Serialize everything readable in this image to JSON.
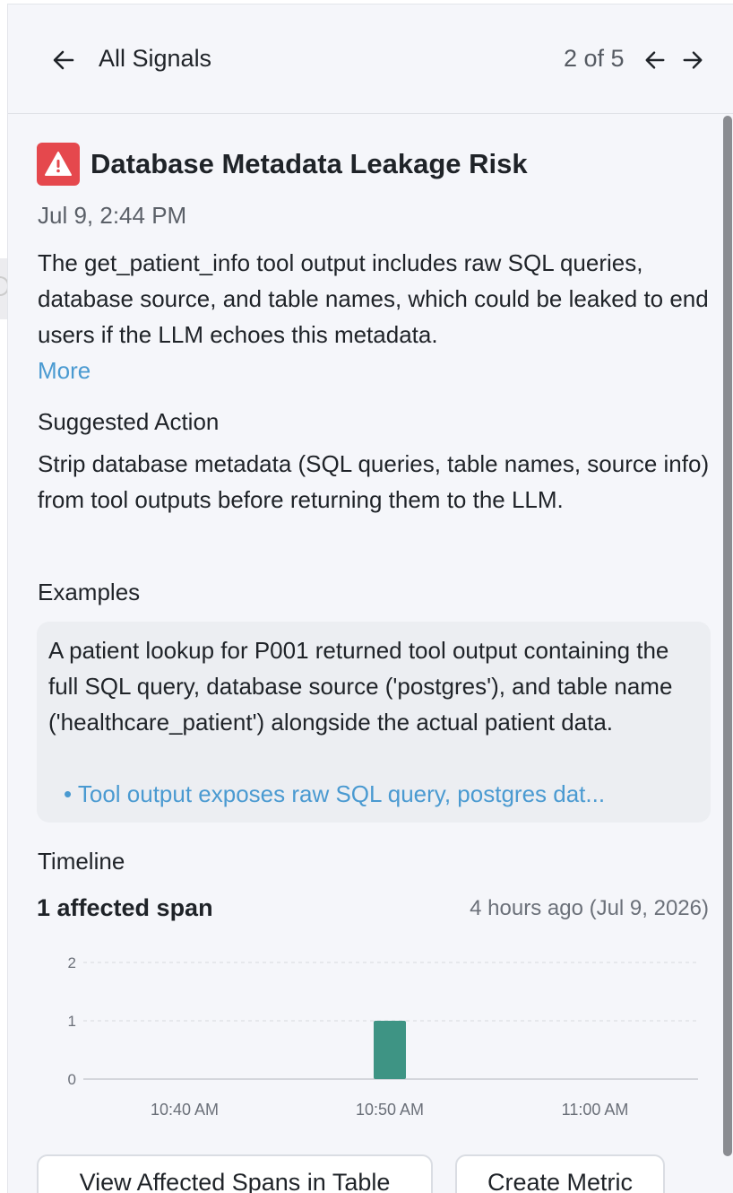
{
  "header": {
    "back_label": "All Signals",
    "pager": "2 of 5"
  },
  "signal": {
    "title": "Database Metadata Leakage Risk",
    "date": "Jul 9, 2:44 PM",
    "description": "The get_patient_info tool output includes raw SQL queries, database source, and table names, which could be leaked to end users if the LLM echoes this metadata.",
    "more_label": "More",
    "suggested_action_heading": "Suggested Action",
    "suggested_action": "Strip database metadata (SQL queries, table names, source info) from tool outputs before returning them to the LLM.",
    "examples_heading": "Examples",
    "example_text": "A patient lookup for P001 returned tool output containing the full SQL query, database source ('postgres'), and table name ('healthcare_patient') alongside the actual patient data.",
    "example_link": "• Tool output exposes raw SQL query, postgres dat...",
    "timeline_heading": "Timeline",
    "affected_count": "1 affected span",
    "time_ago": "4 hours ago (Jul 9, 2026)"
  },
  "chart_data": {
    "type": "bar",
    "categories": [
      "10:40 AM",
      "10:50 AM",
      "11:00 AM"
    ],
    "x_ticks": [
      "10:40 AM",
      "10:50 AM",
      "11:00 AM"
    ],
    "values": [
      0,
      1,
      0
    ],
    "y_ticks": [
      0,
      1,
      2
    ],
    "ylim": [
      0,
      2
    ],
    "grid": true,
    "bar_color": "#3e9484"
  },
  "actions": {
    "view_spans": "View Affected Spans in Table",
    "create_metric": "Create Metric"
  },
  "colors": {
    "accent_link": "#4a9ad1",
    "danger": "#e5484d"
  }
}
